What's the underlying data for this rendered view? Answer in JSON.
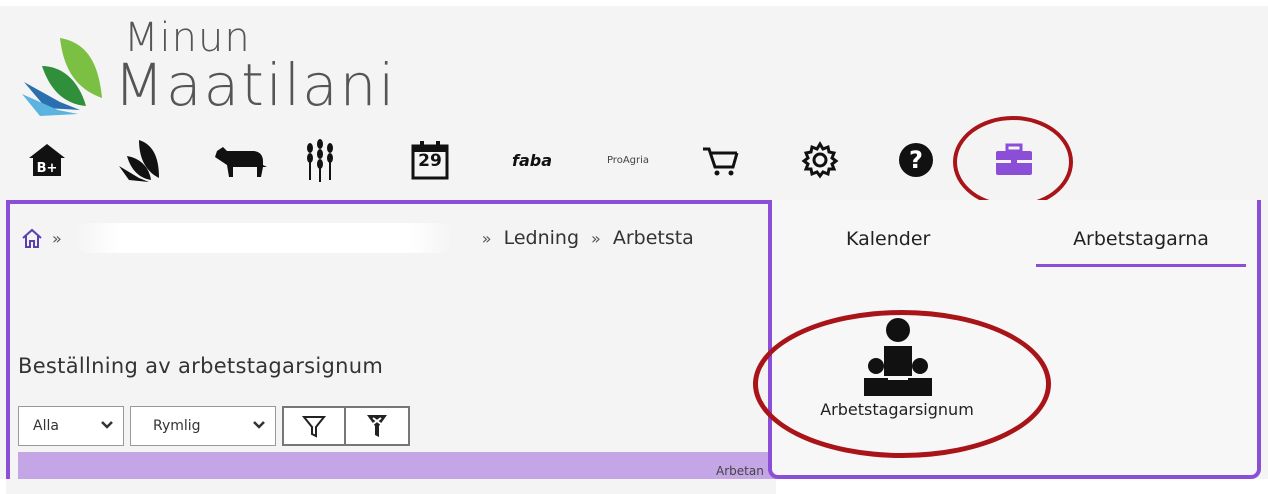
{
  "logo": {
    "line1": "Minun",
    "line2": "Maatilani"
  },
  "nav": {
    "items": [
      {
        "icon": "home-b-plus-icon"
      },
      {
        "icon": "leaf-logo-icon"
      },
      {
        "icon": "cow-icon"
      },
      {
        "icon": "wheat-icon"
      },
      {
        "icon": "calendar-icon",
        "day": "29"
      },
      {
        "icon": "faba-logo",
        "label": "faba"
      },
      {
        "icon": "proagria-logo",
        "label": "ProAgria"
      },
      {
        "icon": "cart-icon"
      },
      {
        "icon": "gear-icon"
      },
      {
        "icon": "help-icon"
      },
      {
        "icon": "briefcase-icon"
      }
    ]
  },
  "breadcrumb": {
    "home_sep": "»",
    "sep1": "»",
    "item1": "Ledning",
    "sep2": "»",
    "item2": "Arbetsta"
  },
  "page": {
    "title": "Beställning av arbetstagarsignum"
  },
  "filters": {
    "select1": "Alla",
    "select2": "Rymlig"
  },
  "table": {
    "header_partial": "Arbetan"
  },
  "dropdown": {
    "tabs": [
      {
        "label": "Kalender",
        "active": false
      },
      {
        "label": "Arbetstagarna",
        "active": true
      }
    ],
    "items": [
      {
        "label": "Arbetstagarsignum",
        "icon": "workers-group-icon"
      }
    ]
  },
  "colors": {
    "accent": "#8a4fd6",
    "annotation": "#a81418",
    "header_bar": "#c4a6e6"
  }
}
